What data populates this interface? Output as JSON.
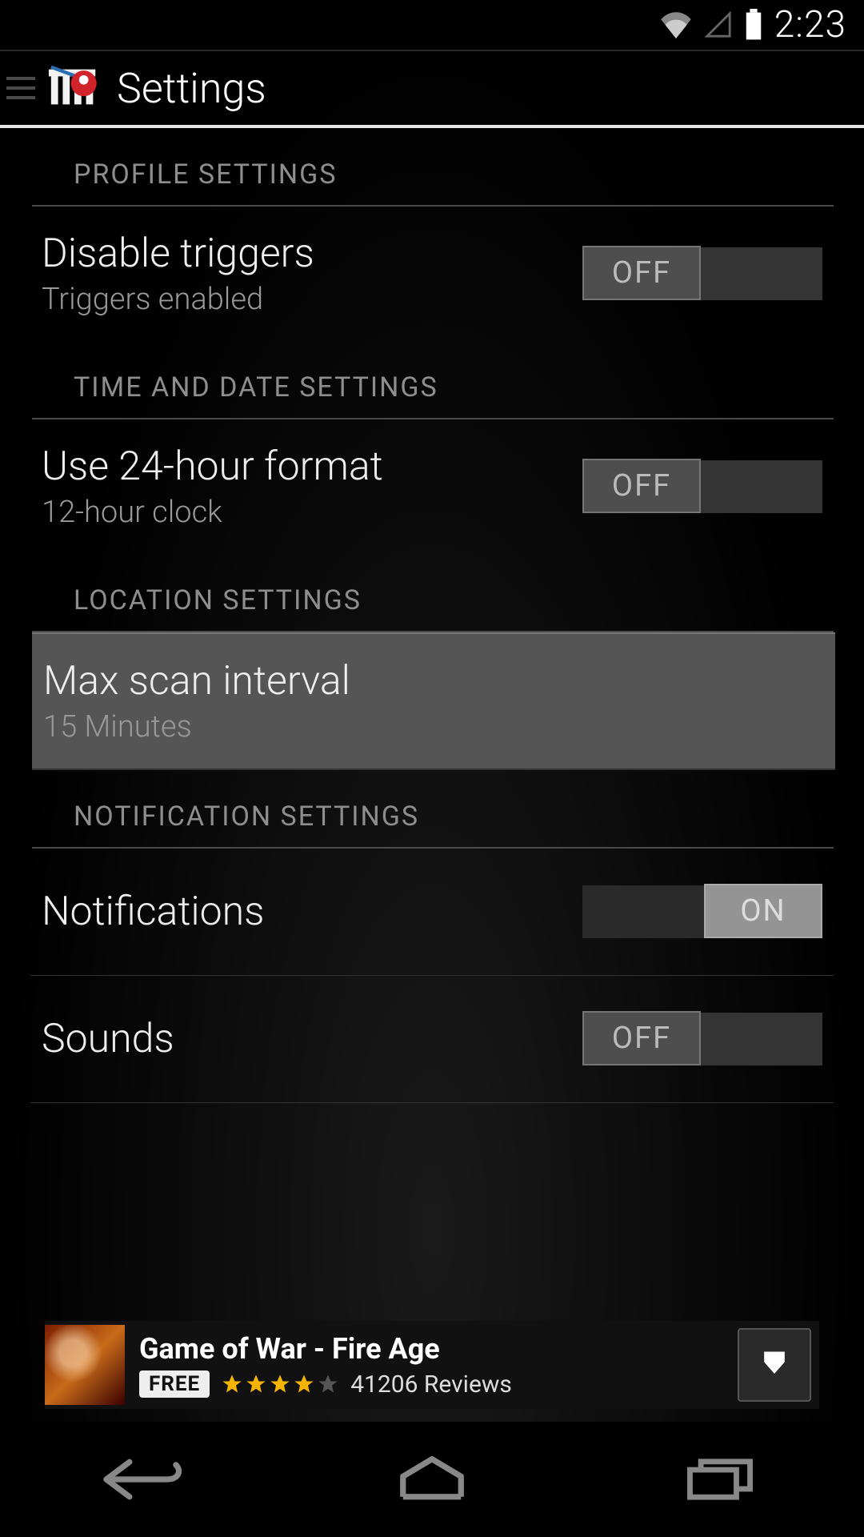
{
  "status": {
    "time": "2:23"
  },
  "appbar": {
    "title": "Settings"
  },
  "sections": {
    "profile": {
      "header": "PROFILE SETTINGS"
    },
    "time_date": {
      "header": "TIME AND DATE SETTINGS"
    },
    "location": {
      "header": "LOCATION SETTINGS"
    },
    "notification": {
      "header": "NOTIFICATION SETTINGS"
    }
  },
  "settings": {
    "disable_triggers": {
      "title": "Disable triggers",
      "subtitle": "Triggers enabled",
      "toggle": "OFF"
    },
    "use_24h": {
      "title": "Use 24-hour format",
      "subtitle": "12-hour clock",
      "toggle": "OFF"
    },
    "max_scan": {
      "title": "Max scan interval",
      "subtitle": "15 Minutes"
    },
    "notifications": {
      "title": "Notifications",
      "toggle": "ON"
    },
    "sounds": {
      "title": "Sounds",
      "toggle": "OFF"
    }
  },
  "ad": {
    "title": "Game of War - Fire Age",
    "price_label": "FREE",
    "reviews": "41206 Reviews",
    "rating": 4
  }
}
